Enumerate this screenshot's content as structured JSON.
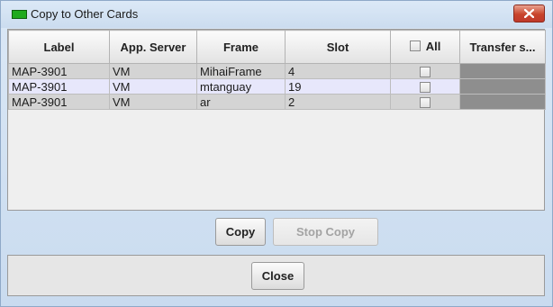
{
  "window": {
    "title": "Copy to Other Cards",
    "accent_icon_color": "#1faa1f",
    "close_button_color": "#c8442b"
  },
  "table": {
    "columns": [
      "Label",
      "App. Server",
      "Frame",
      "Slot",
      "All",
      "Transfer s..."
    ],
    "rows": [
      {
        "label": "MAP-3901",
        "server": "VM",
        "frame": "MihaiFrame",
        "slot": "4",
        "selected": false
      },
      {
        "label": "MAP-3901",
        "server": "VM",
        "frame": "mtanguay",
        "slot": "19",
        "selected": true
      },
      {
        "label": "MAP-3901",
        "server": "VM",
        "frame": "ar",
        "slot": "2",
        "selected": false
      }
    ]
  },
  "buttons": {
    "copy": "Copy",
    "stop_copy": "Stop Copy",
    "close": "Close"
  }
}
